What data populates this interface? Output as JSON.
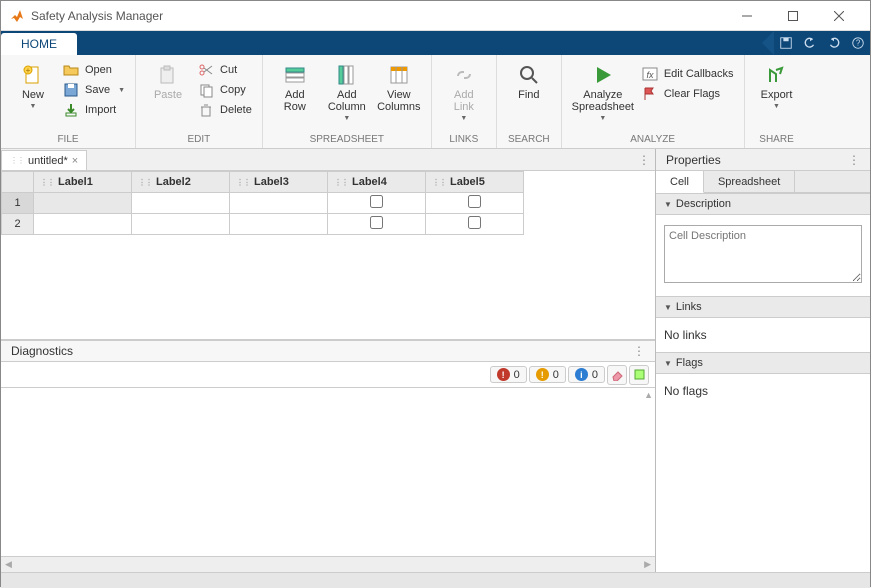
{
  "window": {
    "title": "Safety Analysis Manager"
  },
  "ribbon": {
    "tabs": {
      "home": "HOME"
    },
    "file": {
      "group": "FILE",
      "new": "New",
      "open": "Open",
      "save": "Save",
      "import": "Import"
    },
    "edit": {
      "group": "EDIT",
      "paste": "Paste",
      "cut": "Cut",
      "copy": "Copy",
      "delete": "Delete"
    },
    "spreadsheet": {
      "group": "SPREADSHEET",
      "addRow": "Add\nRow",
      "addColumn": "Add\nColumn",
      "viewColumns": "View\nColumns"
    },
    "links": {
      "group": "LINKS",
      "addLink": "Add\nLink"
    },
    "search": {
      "group": "SEARCH",
      "find": "Find"
    },
    "analyze": {
      "group": "ANALYZE",
      "analyze": "Analyze\nSpreadsheet",
      "editCallbacks": "Edit Callbacks",
      "clearFlags": "Clear Flags"
    },
    "share": {
      "group": "SHARE",
      "export": "Export"
    }
  },
  "doc": {
    "tab_name": "untitled*"
  },
  "spreadsheet": {
    "columns": [
      "Label1",
      "Label2",
      "Label3",
      "Label4",
      "Label5"
    ],
    "rows": [
      {
        "n": "1",
        "cells": [
          "",
          "",
          "",
          "check",
          "check"
        ]
      },
      {
        "n": "2",
        "cells": [
          "",
          "",
          "",
          "check",
          "check"
        ]
      }
    ]
  },
  "diagnostics": {
    "title": "Diagnostics",
    "counts": {
      "error": "0",
      "warn": "0",
      "info": "0"
    }
  },
  "properties": {
    "title": "Properties",
    "tabs": {
      "cell": "Cell",
      "spreadsheet": "Spreadsheet"
    },
    "description": {
      "head": "Description",
      "placeholder": "Cell Description"
    },
    "links": {
      "head": "Links",
      "empty": "No links"
    },
    "flags": {
      "head": "Flags",
      "empty": "No flags"
    }
  }
}
